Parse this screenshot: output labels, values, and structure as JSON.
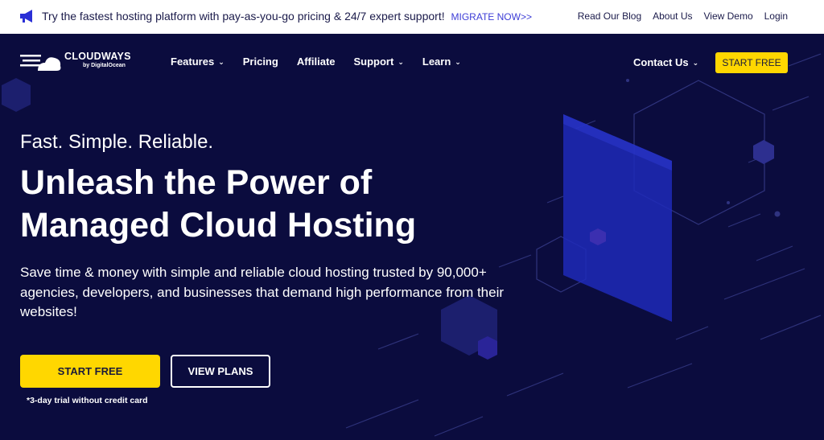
{
  "announcement": {
    "text": "Try the fastest hosting platform with pay-as-you-go pricing & 24/7 expert support!",
    "cta": "MIGRATE NOW>>",
    "icon": "megaphone-icon"
  },
  "utility_links": [
    "Read Our Blog",
    "About Us",
    "View Demo",
    "Login"
  ],
  "brand": {
    "name": "CLOUDWAYS",
    "sub": "by DigitalOcean"
  },
  "nav": {
    "items": [
      {
        "label": "Features",
        "dropdown": true
      },
      {
        "label": "Pricing",
        "dropdown": false
      },
      {
        "label": "Affiliate",
        "dropdown": false
      },
      {
        "label": "Support",
        "dropdown": true
      },
      {
        "label": "Learn",
        "dropdown": true
      }
    ],
    "contact": "Contact Us",
    "cta": "START FREE"
  },
  "hero": {
    "tagline": "Fast. Simple. Reliable.",
    "headline_line1": "Unleash the Power of",
    "headline_line2": "Managed Cloud Hosting",
    "subtext": "Save time & money with simple and reliable cloud hosting trusted by 90,000+ agencies, developers, and businesses that demand high performance from their websites!",
    "primary_cta": "START FREE",
    "secondary_cta": "VIEW PLANS",
    "note": "*3-day trial without credit card"
  },
  "colors": {
    "background": "#0b0c3e",
    "accent": "#ffd700",
    "link": "#3d3dd6",
    "panel": "#1f2ab8"
  }
}
